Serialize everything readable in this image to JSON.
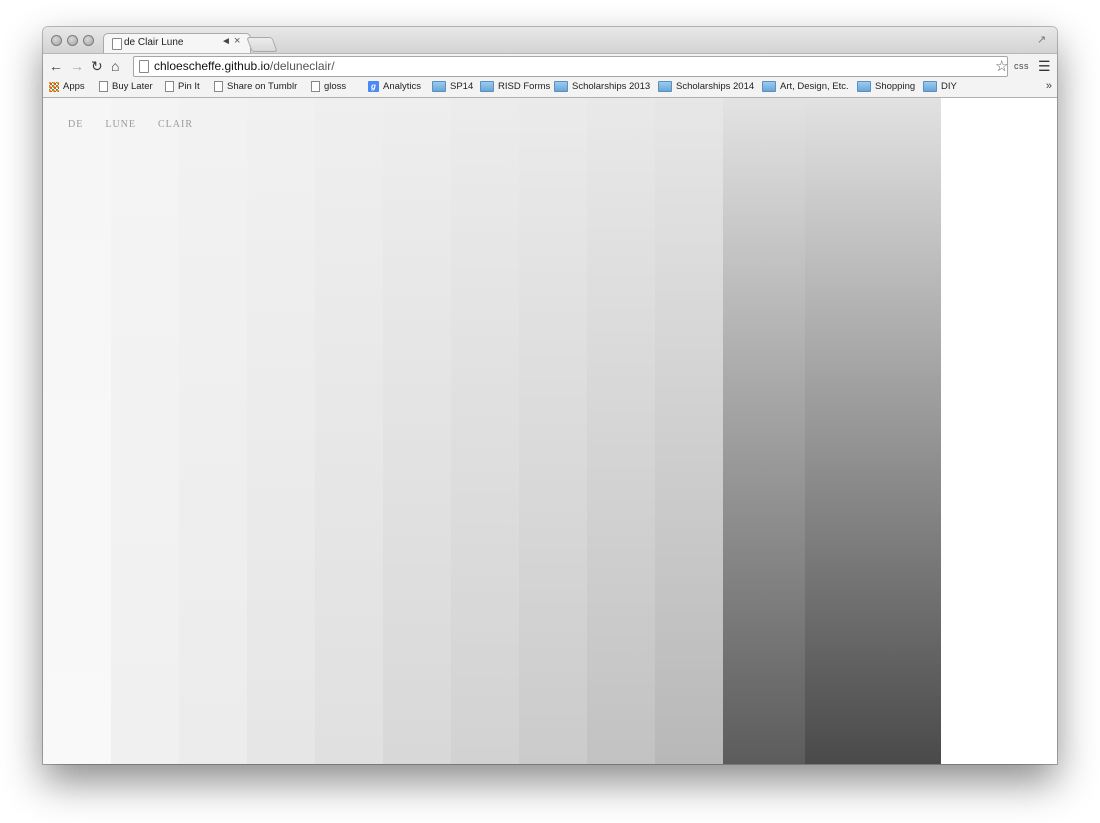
{
  "browser": {
    "tab": {
      "title": "de Clair Lune"
    },
    "url": {
      "host": "chloescheffe.github.io",
      "path": "/deluneclair/"
    },
    "extension_label": "css",
    "bookmarks": [
      {
        "label": "Apps",
        "icon": "apps-icon"
      },
      {
        "label": "Buy Later",
        "icon": "page-icon"
      },
      {
        "label": "Pin It",
        "icon": "page-icon"
      },
      {
        "label": "Share on Tumblr",
        "icon": "page-icon"
      },
      {
        "label": "gloss",
        "icon": "page-icon"
      },
      {
        "label": "Analytics",
        "icon": "google-icon"
      },
      {
        "label": "SP14",
        "icon": "folder-icon"
      },
      {
        "label": "RISD Forms",
        "icon": "folder-icon"
      },
      {
        "label": "Scholarships 2013",
        "icon": "folder-icon"
      },
      {
        "label": "Scholarships 2014",
        "icon": "folder-icon"
      },
      {
        "label": "Art, Design, Etc.",
        "icon": "folder-icon"
      },
      {
        "label": "Shopping",
        "icon": "folder-icon"
      },
      {
        "label": "DIY",
        "icon": "folder-icon"
      }
    ],
    "more_symbol": "»"
  },
  "site": {
    "nav": [
      "DE",
      "LUNE",
      "CLAIR"
    ],
    "stripes": [
      {
        "top": "#f6f6f6",
        "bottom": "#f9f9f9"
      },
      {
        "top": "#f4f4f4",
        "bottom": "#f0f0f0"
      },
      {
        "top": "#f2f2f2",
        "bottom": "#ececec"
      },
      {
        "top": "#f1f1f1",
        "bottom": "#e6e6e6"
      },
      {
        "top": "#efefef",
        "bottom": "#e0e0e0"
      },
      {
        "top": "#eeeeee",
        "bottom": "#d8d8d8"
      },
      {
        "top": "#ececec",
        "bottom": "#d2d2d2"
      },
      {
        "top": "#ebebeb",
        "bottom": "#cbcbcb"
      },
      {
        "top": "#e9e9e9",
        "bottom": "#c2c2c2"
      },
      {
        "top": "#e7e7e7",
        "bottom": "#b8b8b8"
      },
      {
        "top": "#e3e3e3",
        "bottom": "#5c5c5c"
      },
      {
        "top": "#e2e2e2",
        "bottom": "#4a4a4a"
      }
    ]
  }
}
